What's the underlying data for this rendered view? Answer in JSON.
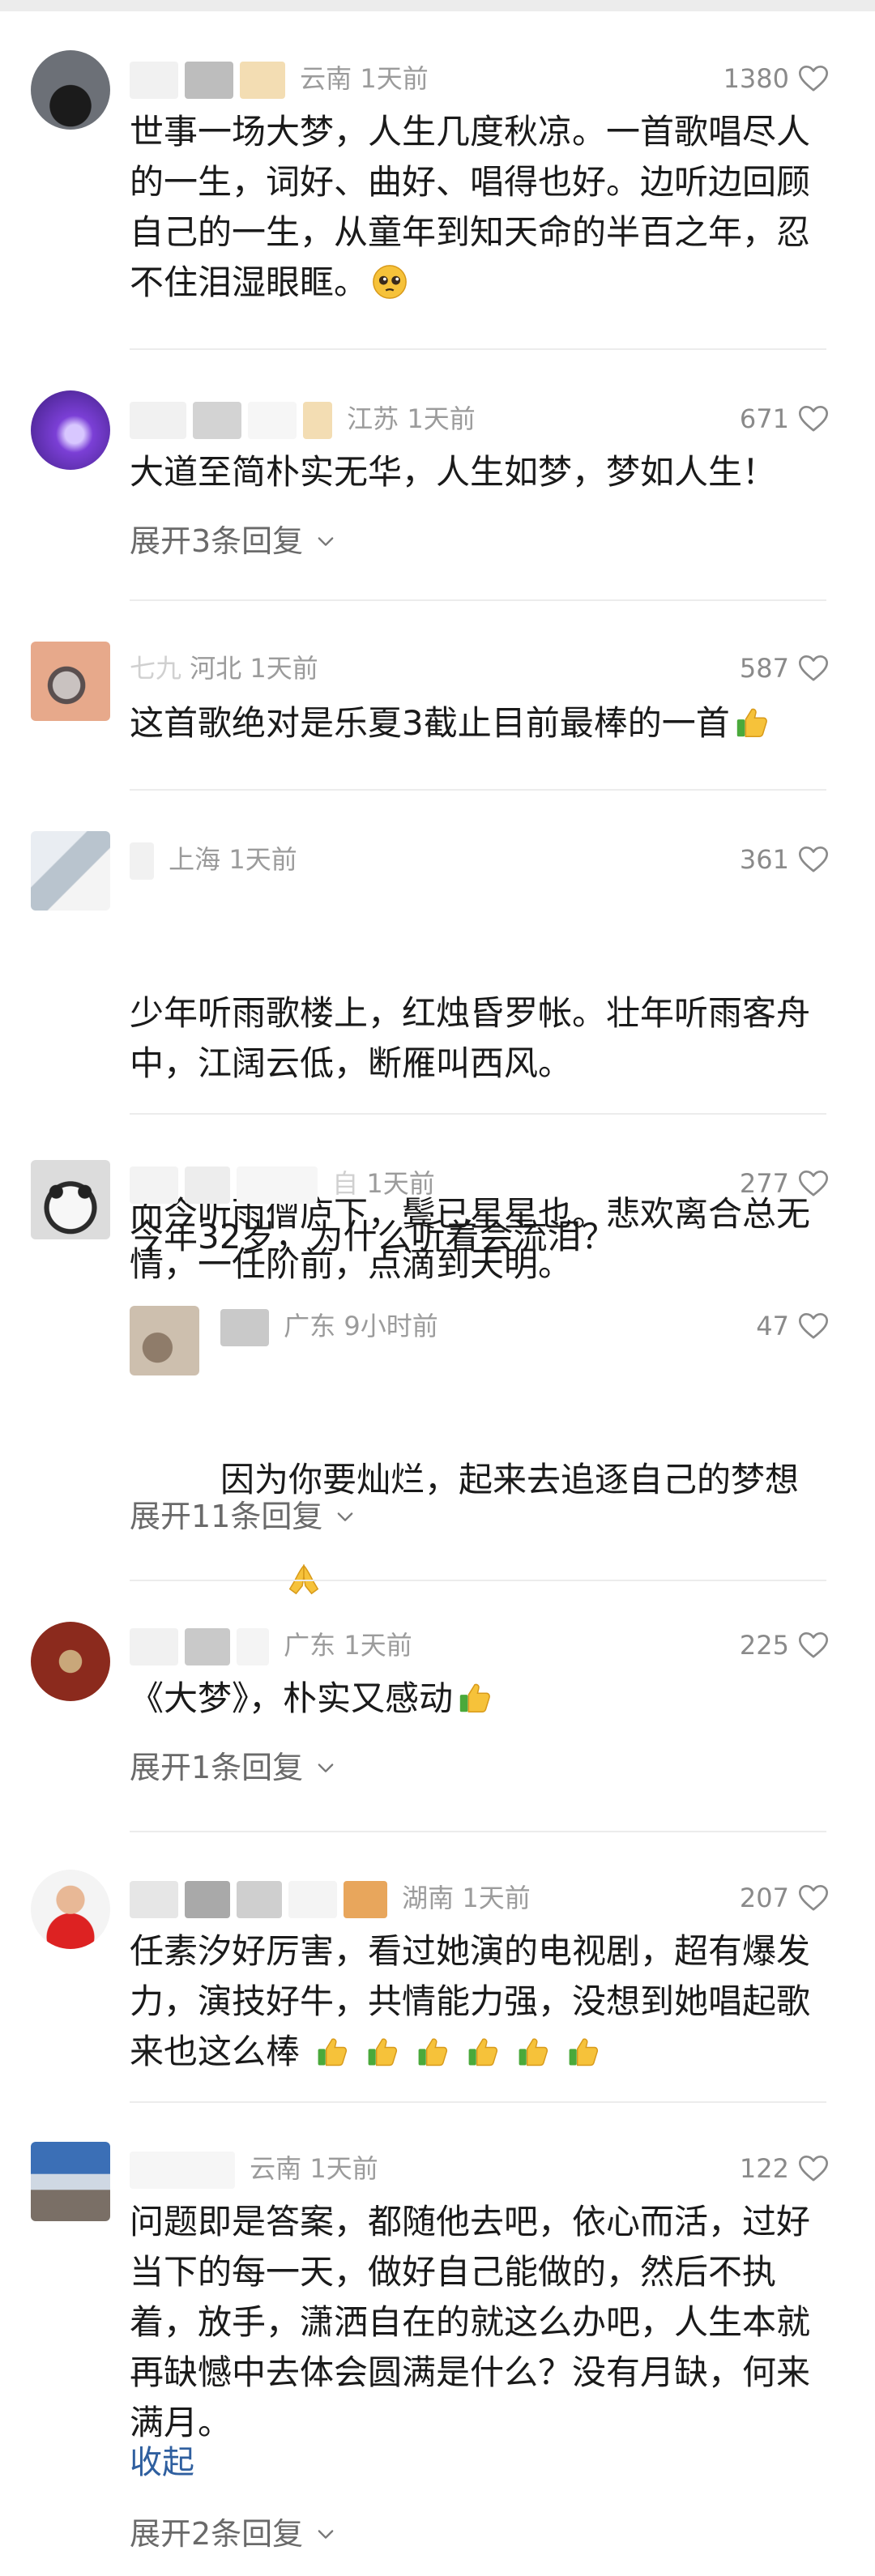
{
  "comments": [
    {
      "region": "云南",
      "time": "1天前",
      "likes": "1380",
      "text": "世事一场大梦，人生几度秋凉。一首歌唱尽人的一生，词好、曲好、唱得也好。边听边回顾自己的一生，从童年到知天命的半百之年，忍不住泪湿眼眶。",
      "emoji": "pleading-face-emoji"
    },
    {
      "region": "江苏",
      "time": "1天前",
      "likes": "671",
      "text": "大道至简朴实无华，人生如梦，梦如人生！",
      "expand": "展开3条回复"
    },
    {
      "region_prefix": "七九",
      "region": "河北",
      "time": "1天前",
      "likes": "587",
      "text": "这首歌绝对是乐夏3截止目前最棒的一首",
      "emoji": "thumbs-up-emoji"
    },
    {
      "region": "上海",
      "time": "1天前",
      "likes": "361",
      "text_lines": [
        "少年听雨歌楼上，红烛昏罗帐。壮年听雨客舟中，江阔云低，断雁叫西风。",
        "而今听雨僧庐下，鬓已星星也。悲欢离合总无情，一任阶前，点滴到天明。"
      ]
    },
    {
      "name_tail": "自",
      "time": "1天前",
      "likes": "277",
      "text": "今年32岁，为什么听着会流泪？",
      "reply": {
        "region": "广东",
        "time": "9小时前",
        "likes": "47",
        "text": "因为你要灿烂，起来去追逐自己的梦想",
        "emoji": "folded-hands-emoji"
      },
      "expand": "展开11条回复"
    },
    {
      "region": "广东",
      "time": "1天前",
      "likes": "225",
      "text": "《大梦》，朴实又感动",
      "emoji": "thumbs-up-emoji",
      "expand": "展开1条回复"
    },
    {
      "region": "湖南",
      "time": "1天前",
      "likes": "207",
      "text": "任素汐好厉害，看过她演的电视剧，超有爆发力，演技好牛，共情能力强，没想到她唱起歌来也这么棒",
      "emoji_count": 6
    },
    {
      "region": "云南",
      "time": "1天前",
      "likes": "122",
      "text": "问题即是答案，都随他去吧，依心而活，过好当下的每一天，做好自己能做的，然后不执着，放手，潇洒自在的就这么办吧，人生本就再缺憾中去体会圆满是什么？没有月缺，何来满月。",
      "collapse": "收起",
      "expand": "展开2条回复"
    }
  ],
  "colors": {
    "meta": "#9b9b9b",
    "text": "#1a1a1a",
    "link": "#2f5f9f",
    "separator": "#ececec"
  }
}
